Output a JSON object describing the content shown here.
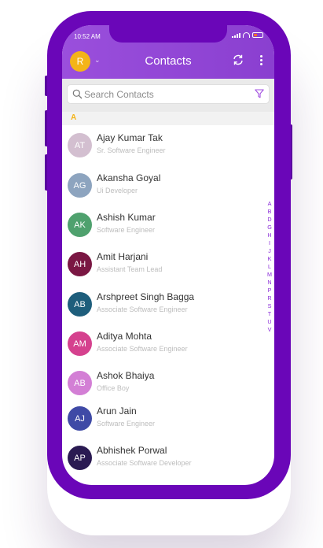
{
  "status": {
    "time": "10:52 AM"
  },
  "header": {
    "avatar_initial": "R",
    "title": "Contacts"
  },
  "search": {
    "placeholder": "Search Contacts"
  },
  "section_letter": "A",
  "contacts": [
    {
      "initials": "AT",
      "name": "Ajay Kumar Tak",
      "role": "Sr. Software Engineer",
      "color": "#d3bfd0"
    },
    {
      "initials": "AG",
      "name": "Akansha Goyal",
      "role": "Ui Developer",
      "color": "#8da4bf"
    },
    {
      "initials": "AK",
      "name": "Ashish Kumar",
      "role": "Software Engineer",
      "color": "#4fa16e"
    },
    {
      "initials": "AH",
      "name": "Amit Harjani",
      "role": "Assistant Team Lead",
      "color": "#7a1743"
    },
    {
      "initials": "AB",
      "name": "Arshpreet Singh Bagga",
      "role": "Associate Software Engineer",
      "color": "#1e5e7c"
    },
    {
      "initials": "AM",
      "name": "Aditya Mohta",
      "role": "Associate Software Engineer",
      "color": "#d5418e"
    },
    {
      "initials": "AB",
      "name": "Ashok Bhaiya",
      "role": "Office Boy",
      "color": "#d37fd5"
    },
    {
      "initials": "AJ",
      "name": "Arun Jain",
      "role": "Software Engineer",
      "color": "#3f4aa6"
    },
    {
      "initials": "AP",
      "name": "Abhishek Porwal",
      "role": "Associate Software Developer",
      "color": "#2a1a52"
    }
  ],
  "alphabet_index": [
    "A",
    "B",
    "D",
    "G",
    "H",
    "I",
    "J",
    "K",
    "L",
    "M",
    "N",
    "P",
    "R",
    "S",
    "T",
    "U",
    "V"
  ],
  "colors": {
    "header": "#9a4fdc",
    "phone_body": "#6a06b8",
    "accent": "#f4b418",
    "index_text": "#8a2cd8"
  }
}
